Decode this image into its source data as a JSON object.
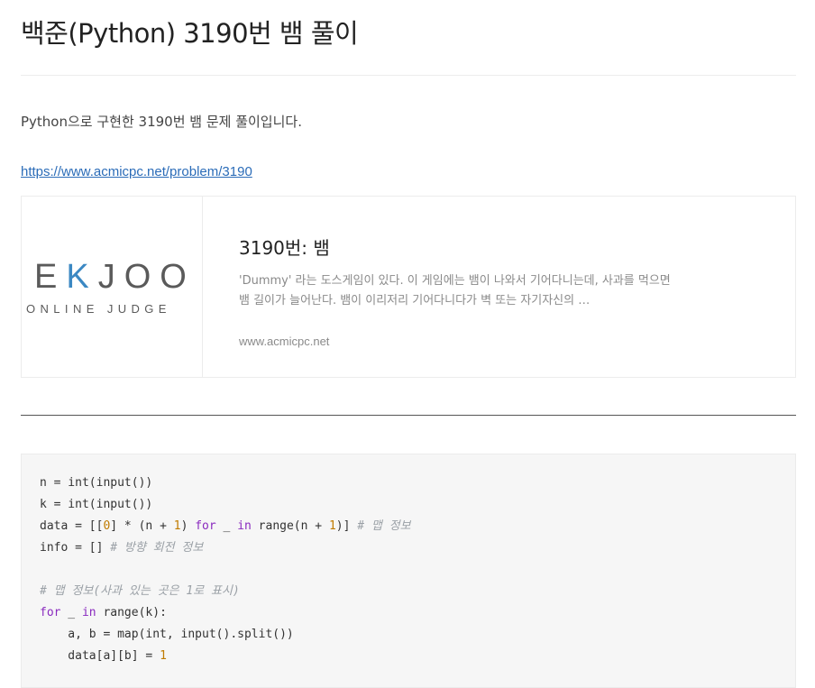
{
  "post": {
    "title": "백준(Python) 3190번 뱀 풀이",
    "intro": "Python으로 구현한 3190번 뱀 문제 풀이입니다.",
    "link": "https://www.acmicpc.net/problem/3190"
  },
  "og_card": {
    "logo_letters": [
      "E",
      "K",
      "JOO"
    ],
    "logo_sub": "ONLINE JUDGE",
    "title": "3190번: 뱀",
    "description": " 'Dummy' 라는 도스게임이 있다. 이 게임에는 뱀이 나와서 기어다니는데, 사과를 먹으면 뱀 길이가 늘어난다. 뱀이 이리저리 기어다니다가 벽 또는 자기자신의 …",
    "site": "www.acmicpc.net",
    "brand_color": "#3b88c3"
  },
  "code": {
    "lines": [
      [
        {
          "t": "n = int(input())",
          "c": ""
        }
      ],
      [
        {
          "t": "k = int(input())",
          "c": ""
        }
      ],
      [
        {
          "t": "data = [[",
          "c": ""
        },
        {
          "t": "0",
          "c": "num"
        },
        {
          "t": "] * (n + ",
          "c": ""
        },
        {
          "t": "1",
          "c": "num"
        },
        {
          "t": ") ",
          "c": ""
        },
        {
          "t": "for",
          "c": "kw"
        },
        {
          "t": " _ ",
          "c": ""
        },
        {
          "t": "in",
          "c": "kw"
        },
        {
          "t": " range(n + ",
          "c": ""
        },
        {
          "t": "1",
          "c": "num"
        },
        {
          "t": ")] ",
          "c": ""
        },
        {
          "t": "# 맵 정보",
          "c": "cm"
        }
      ],
      [
        {
          "t": "info = [] ",
          "c": ""
        },
        {
          "t": "# 방향 회전 정보",
          "c": "cm"
        }
      ],
      [
        {
          "t": "",
          "c": ""
        }
      ],
      [
        {
          "t": "# 맵 정보(사과 있는 곳은 1로 표시)",
          "c": "cm"
        }
      ],
      [
        {
          "t": "for",
          "c": "kw"
        },
        {
          "t": " _ ",
          "c": ""
        },
        {
          "t": "in",
          "c": "kw"
        },
        {
          "t": " range(k):",
          "c": ""
        }
      ],
      [
        {
          "t": "    a, b = map(int, input().split())",
          "c": ""
        }
      ],
      [
        {
          "t": "    data[a][b] = ",
          "c": ""
        },
        {
          "t": "1",
          "c": "num"
        }
      ]
    ],
    "colors": {
      "keyword": "#8a2bbf",
      "number": "#c07b00",
      "comment": "#9aa0a6"
    }
  }
}
